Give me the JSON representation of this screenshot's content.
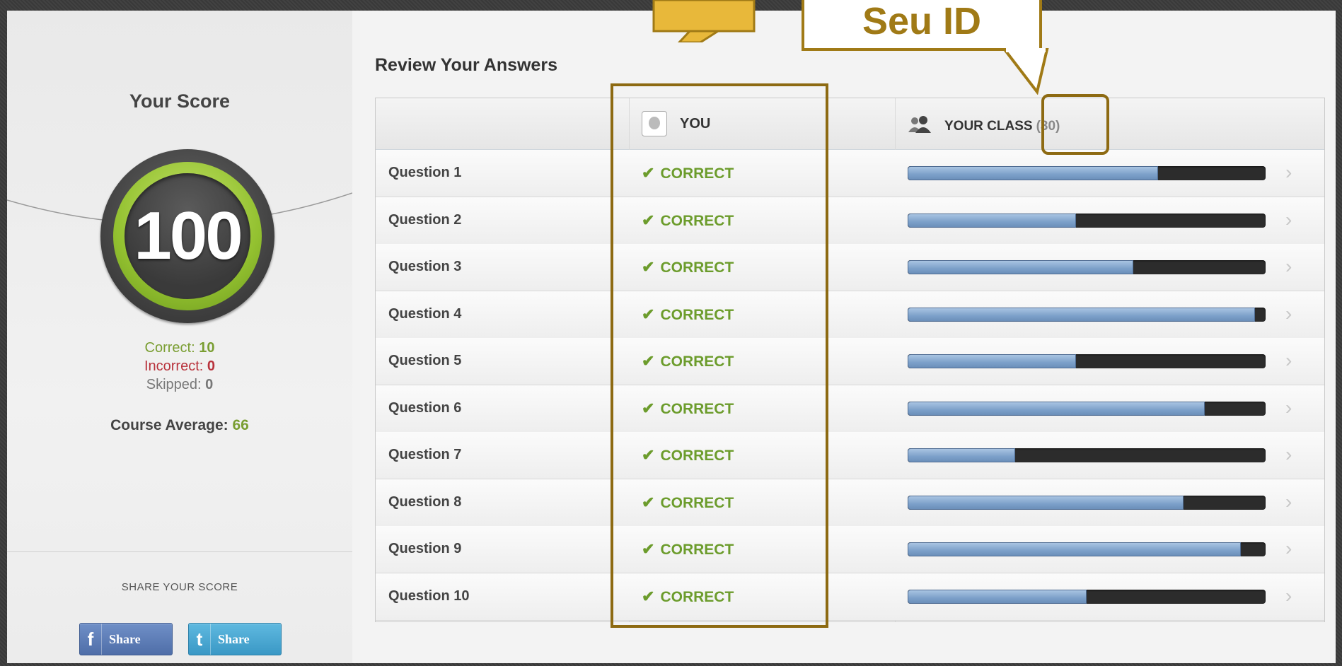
{
  "sidebar": {
    "score_title": "Your Score",
    "score_value": "100",
    "correct_label": "Correct:",
    "correct_value": "10",
    "incorrect_label": "Incorrect:",
    "incorrect_value": "0",
    "skipped_label": "Skipped:",
    "skipped_value": "0",
    "course_average_label": "Course Average:",
    "course_average_value": "66",
    "share_title": "SHARE YOUR SCORE",
    "facebook_share_label": "Share",
    "twitter_share_label": "Share",
    "facebook_icon": "f",
    "twitter_icon": "t"
  },
  "main": {
    "review_title": "Review Your Answers",
    "header": {
      "you_label": "YOU",
      "class_label": "YOUR CLASS",
      "class_count": "(30)"
    },
    "rows": [
      {
        "question": "Question 1",
        "result": "CORRECT",
        "class_fraction": 0.7
      },
      {
        "question": "Question 2",
        "result": "CORRECT",
        "class_fraction": 0.47
      },
      {
        "question": "Question 3",
        "result": "CORRECT",
        "class_fraction": 0.63
      },
      {
        "question": "Question 4",
        "result": "CORRECT",
        "class_fraction": 0.97
      },
      {
        "question": "Question 5",
        "result": "CORRECT",
        "class_fraction": 0.47
      },
      {
        "question": "Question 6",
        "result": "CORRECT",
        "class_fraction": 0.83
      },
      {
        "question": "Question 7",
        "result": "CORRECT",
        "class_fraction": 0.3
      },
      {
        "question": "Question 8",
        "result": "CORRECT",
        "class_fraction": 0.77
      },
      {
        "question": "Question 9",
        "result": "CORRECT",
        "class_fraction": 0.93
      },
      {
        "question": "Question 10",
        "result": "CORRECT",
        "class_fraction": 0.5
      }
    ]
  },
  "annotation": {
    "callout_text": "Seu ID"
  },
  "colors": {
    "correct_green": "#6c9c2c",
    "incorrect_red": "#b8323c",
    "annotation_gold": "#8d6a12",
    "bar_fill_blue": "#7ca0c9"
  }
}
